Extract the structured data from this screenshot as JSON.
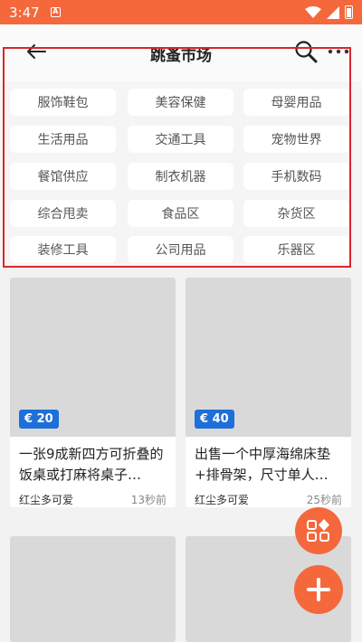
{
  "status_bar": {
    "time": "3:47",
    "notification_glyph": "A"
  },
  "header": {
    "title": "跳蚤市场"
  },
  "categories": [
    "服饰鞋包",
    "美容保健",
    "母婴用品",
    "生活用品",
    "交通工具",
    "宠物世界",
    "餐馆供应",
    "制衣机器",
    "手机数码",
    "综合甩卖",
    "食品区",
    "杂货区",
    "装修工具",
    "公司用品",
    "乐器区"
  ],
  "listings": [
    {
      "price": "€ 20",
      "title": "一张9成新四方可折叠的饭桌或打麻将桌子…",
      "user": "红尘多可爱",
      "time": "13秒前"
    },
    {
      "price": "€ 40",
      "title": "出售一个中厚海绵床垫+排骨架，尺寸单人…",
      "user": "红尘多可爱",
      "time": "25秒前"
    }
  ],
  "colors": {
    "accent": "#f4683c",
    "price_badge": "#1e6fd9",
    "highlight": "#d9262b"
  },
  "icons": {
    "back": "arrow-left-icon",
    "search": "search-icon",
    "more": "more-horizontal-icon",
    "category_fab": "grid-category-icon",
    "add_fab": "plus-icon"
  }
}
